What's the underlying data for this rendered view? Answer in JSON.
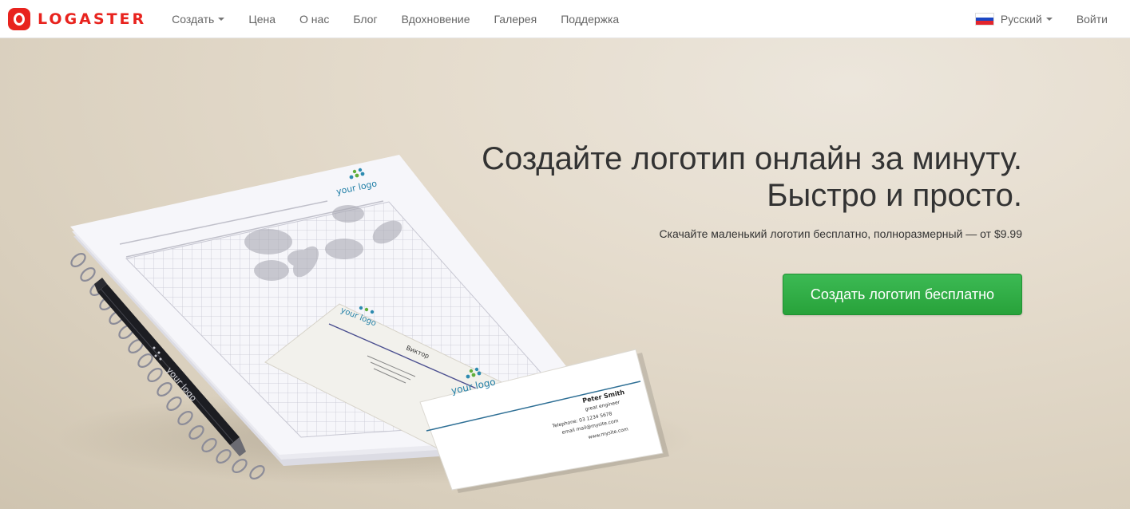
{
  "brand": {
    "name": "LOGASTER",
    "color": "#e8231e"
  },
  "nav": {
    "items": [
      {
        "label": "Создать",
        "has_dropdown": true
      },
      {
        "label": "Цена"
      },
      {
        "label": "О нас"
      },
      {
        "label": "Блог"
      },
      {
        "label": "Вдохновение"
      },
      {
        "label": "Галерея"
      },
      {
        "label": "Поддержка"
      }
    ],
    "language": {
      "label": "Русский",
      "flag_icon": "russia-flag-icon"
    },
    "login_label": "Войти"
  },
  "hero": {
    "headline_line1": "Создайте логотип онлайн за минуту.",
    "headline_line2": "Быстро и просто.",
    "subline": "Скачайте маленький логотип бесплатно, полноразмерный — от $9.99",
    "cta_label": "Создать логотип бесплатно",
    "cta_color": "#2eaa43"
  },
  "mockup": {
    "notebook_logo_text": "your logo",
    "pen_logo_text": "your logo",
    "back_card": {
      "logo_text": "your logo",
      "name": "Виктор"
    },
    "front_card": {
      "logo_text": "your logo",
      "name": "Peter Smith",
      "title": "great engineer",
      "telephone": "Telephone: 03 1234 5678",
      "email": "email mail@mysite.com",
      "website": "www.mysite.com"
    }
  }
}
